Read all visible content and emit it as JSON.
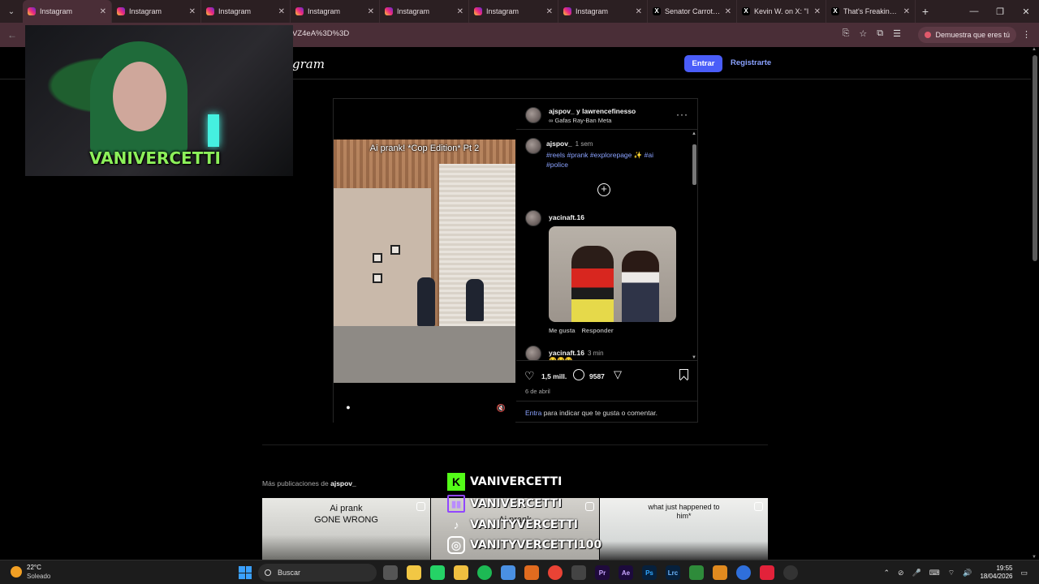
{
  "browser": {
    "tabs": [
      {
        "title": "Instagram",
        "icon": "instagram-icon",
        "active": true
      },
      {
        "title": "Instagram",
        "icon": "instagram-icon",
        "active": false
      },
      {
        "title": "Instagram",
        "icon": "instagram-icon",
        "active": false
      },
      {
        "title": "Instagram",
        "icon": "instagram-icon",
        "active": false
      },
      {
        "title": "Instagram",
        "icon": "instagram-icon",
        "active": false
      },
      {
        "title": "Instagram",
        "icon": "instagram-icon",
        "active": false
      },
      {
        "title": "Instagram",
        "icon": "instagram-icon",
        "active": false
      },
      {
        "title": "Senator Carrot (R",
        "icon": "x-icon",
        "active": false
      },
      {
        "title": "Kevin W. on X: \"I",
        "icon": "x-icon",
        "active": false
      },
      {
        "title": "That's Freaking A",
        "icon": "x-icon",
        "active": false
      }
    ],
    "url": "VZ4eA%3D%3D",
    "verify_label": "Demuestra que eres tú"
  },
  "header": {
    "logo": "gram",
    "login_label": "Entrar",
    "signup_label": "Registrarte"
  },
  "post": {
    "video_caption": "Ai prank! *Cop Edition* Pt 2",
    "author_line": "ajspov_ y lawrencefinesso",
    "subline": "Gafas Ray-Ban Meta",
    "caption_user": "ajspov_",
    "caption_time": "1 sem",
    "caption_tags": "#reels #prank #explorepage ✨ #ai #police",
    "comment1_user": "yacinaft.16",
    "comment1_like": "Me gusta",
    "comment1_reply": "Responder",
    "comment2_user": "yacinaft.16",
    "comment2_time": "3 min",
    "comment2_text": "😂😂😂",
    "likes": "1,5 mill.",
    "comments": "9587",
    "date": "6 de abril",
    "login_link": "Entra",
    "login_text": " para indicar que te gusta o comentar."
  },
  "more": {
    "label": "Más publicaciones de ",
    "user": "ajspov_",
    "thumbs": [
      {
        "caption": "Ai prank\nGONE WRONG"
      },
      {
        "caption": "Ai prank"
      },
      {
        "caption": "what just happened to\nhim*"
      }
    ]
  },
  "stream": {
    "webcam_name": "VANIVERCETTI",
    "socials": [
      {
        "icon": "kick-icon",
        "text": "VANIVERCETTI"
      },
      {
        "icon": "twitch-icon",
        "text": "VANIVERCETTI"
      },
      {
        "icon": "tiktok-icon",
        "text": "VANITYVERCETTI"
      },
      {
        "icon": "instagram-icon",
        "text": "VANITYVERCETTI100"
      }
    ]
  },
  "taskbar": {
    "weather_temp": "22°C",
    "weather_desc": "Soleado",
    "search_label": "Buscar",
    "time": "19:55",
    "date": "18/04/2026"
  },
  "colors": {
    "accent_button": "#4a5df9",
    "link": "#8aa2ff",
    "chrome_bg": "#4a2e37"
  }
}
